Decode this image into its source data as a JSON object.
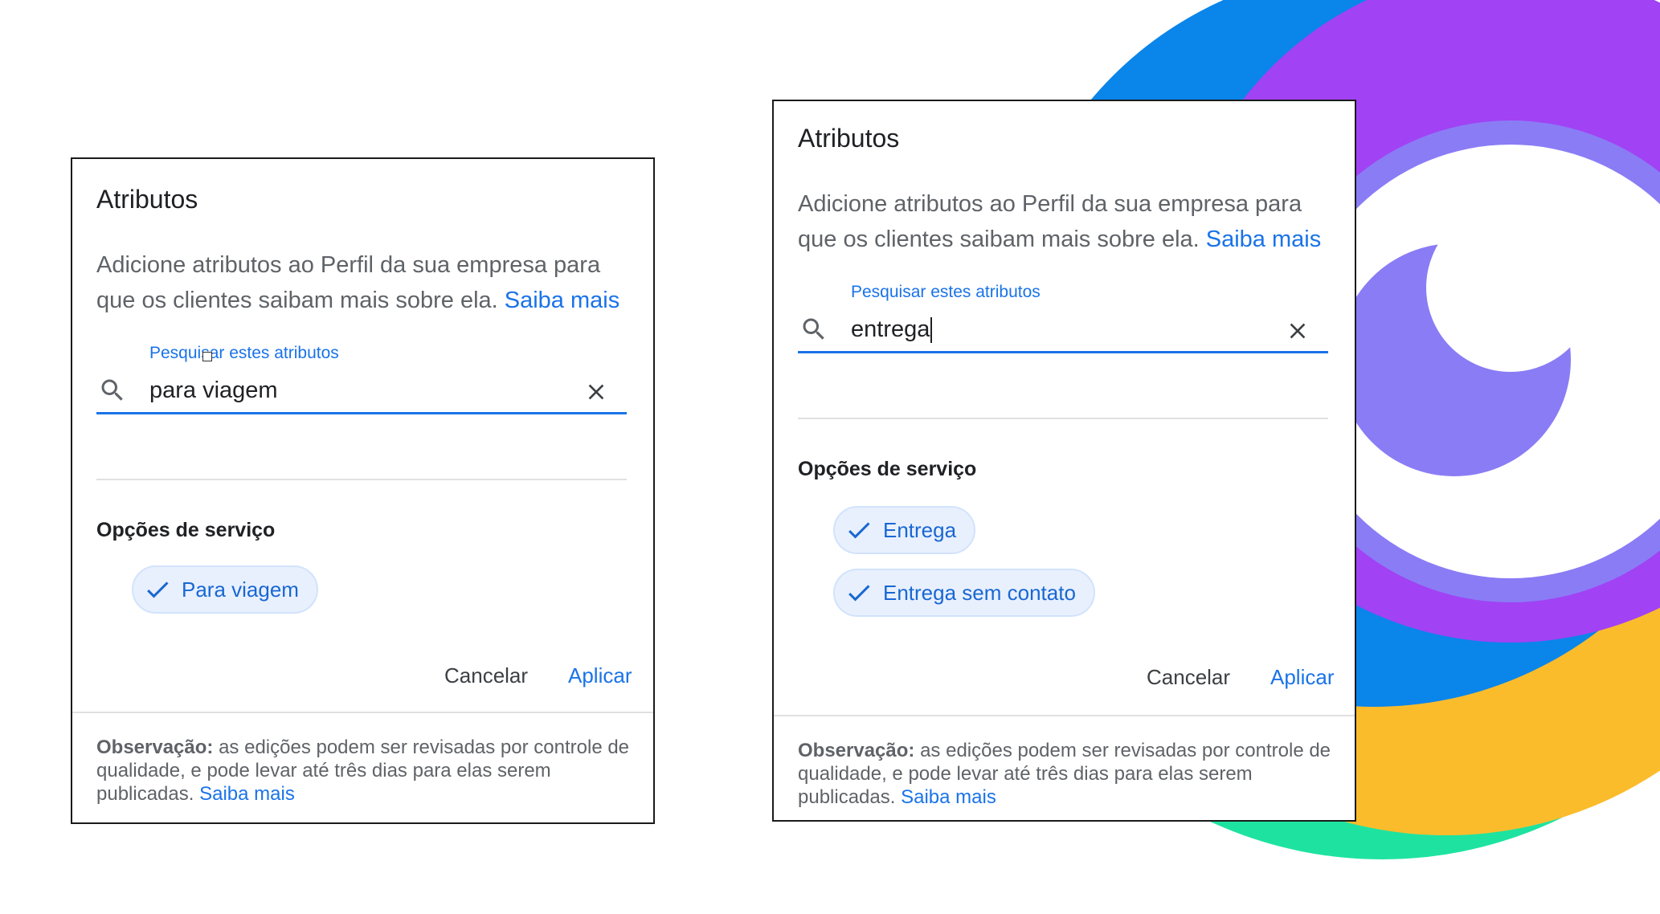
{
  "colors": {
    "accent": "#1a73e8",
    "chip_bg": "#e8f0fe",
    "decor_blue": "#0a85ea",
    "decor_purple": "#a142f4",
    "decor_violet": "#8a7cf5",
    "decor_yellow": "#fbbc2c",
    "decor_green": "#1ee3a0"
  },
  "left_dialog": {
    "title": "Atributos",
    "description": "Adicione atributos ao Perfil da sua empresa para que os clientes saibam mais sobre ela.",
    "learn_more": "Saiba mais",
    "search_label": "Pesquisar estes atributos",
    "search_value": "para viagem",
    "section_title": "Opções de serviço",
    "chips": [
      {
        "label": "Para viagem",
        "selected": true
      }
    ],
    "cancel": "Cancelar",
    "apply": "Aplicar",
    "note_bold": "Observação:",
    "note_text": "as edições podem ser revisadas por controle de qualidade, e pode levar até três dias para elas serem publicadas.",
    "note_link": "Saiba mais"
  },
  "right_dialog": {
    "title": "Atributos",
    "description": "Adicione atributos ao Perfil da sua empresa para que os clientes saibam mais sobre ela.",
    "learn_more": "Saiba mais",
    "search_label": "Pesquisar estes atributos",
    "search_value": "entrega",
    "section_title": "Opções de serviço",
    "chips": [
      {
        "label": "Entrega",
        "selected": true
      },
      {
        "label": "Entrega sem contato",
        "selected": true
      }
    ],
    "cancel": "Cancelar",
    "apply": "Aplicar",
    "note_bold": "Observação:",
    "note_text": "as edições podem ser revisadas por controle de qualidade, e pode levar até três dias para elas serem publicadas.",
    "note_link": "Saiba mais"
  }
}
